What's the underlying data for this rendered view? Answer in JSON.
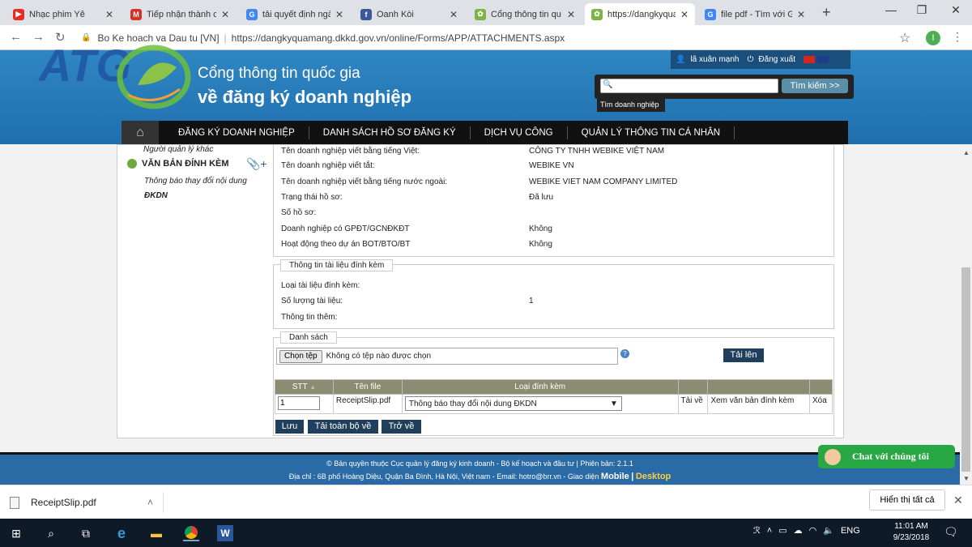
{
  "browser": {
    "tabs": [
      {
        "title": "Nhạc phim Yê",
        "fav_color": "#e52d27",
        "fav_char": "▶"
      },
      {
        "title": "Tiếp nhận thành c",
        "fav_color": "#d93025",
        "fav_char": "M"
      },
      {
        "title": "tải quyết định ngà",
        "fav_color": "#4285f4",
        "fav_char": "G"
      },
      {
        "title": "Oanh Kòi",
        "fav_color": "#3b5998",
        "fav_char": "f"
      },
      {
        "title": "Cổng thông tin qu",
        "fav_color": "#7cb342",
        "fav_char": "✿"
      },
      {
        "title": "https://dangkyqua",
        "fav_color": "#7cb342",
        "fav_char": "✿"
      },
      {
        "title": "file pdf - Tìm với G",
        "fav_color": "#4285f4",
        "fav_char": "G"
      }
    ],
    "site_name": "Bo Ke hoach va Dau tu [VN]",
    "url": "https://dangkyquamang.dkkd.gov.vn/online/Forms/APP/ATTACHMENTS.aspx",
    "profile_initial": "I"
  },
  "header": {
    "title_line1": "Cổng thông tin quốc gia",
    "title_line2": "về đăng ký doanh nghiệp",
    "user_name": "lã xuân mạnh",
    "logout": "Đăng xuất",
    "search_button": "Tìm kiếm >>",
    "search_hint": "Tìm doanh nghiệp",
    "search_value": ""
  },
  "nav": [
    "ĐĂNG KÝ DOANH NGHIỆP",
    "DANH SÁCH HỒ SƠ ĐĂNG KÝ",
    "DỊCH VỤ CÔNG",
    "QUẢN LÝ THÔNG TIN CÁ NHÂN"
  ],
  "sidebar": {
    "prev_item": "Người quản lý khác",
    "active_item": "VĂN BẢN ĐÍNH KÈM",
    "sub_item_line1": "Thông báo thay đổi nội dung",
    "sub_item_line2": "ĐKDN"
  },
  "company_info": [
    {
      "label": "Tên doanh nghiệp viết bằng tiếng Việt:",
      "value": "CÔNG TY TNHH WEBIKE VIỆT NAM"
    },
    {
      "label": "Tên doanh nghiệp viết tắt:",
      "value": "WEBIKE VN"
    },
    {
      "label": "Tên doanh nghiệp viết bằng tiếng nước ngoài:",
      "value": "WEBIKE VIET NAM COMPANY LIMITED"
    },
    {
      "label": "Trạng thái hồ sơ:",
      "value": "Đã lưu"
    },
    {
      "label": "Số hồ sơ:",
      "value": ""
    },
    {
      "label": "Doanh nghiệp có GPĐT/GCNĐKĐT",
      "value": "Không"
    },
    {
      "label": "Hoạt động theo dự án BOT/BTO/BT",
      "value": "Không"
    }
  ],
  "attachment_info": {
    "legend": "Thông tin tài liệu đính kèm",
    "rows": [
      {
        "label": "Loại tài liệu đính kèm:",
        "value": ""
      },
      {
        "label": "Số lượng tài liệu:",
        "value": "1"
      },
      {
        "label": "Thông tin thêm:",
        "value": ""
      }
    ]
  },
  "list": {
    "legend": "Danh sách",
    "choose_file": "Chọn tệp",
    "no_file": "Không có tệp nào được chọn",
    "upload": "Tải lên",
    "columns": [
      "STT",
      "Tên file",
      "Loại đính kèm"
    ],
    "row": {
      "stt": "1",
      "file_name": "ReceiptSlip.pdf",
      "type": "Thông báo thay đổi nội dung ĐKDN",
      "download": "Tải về",
      "view": "Xem văn bản đính kèm",
      "delete": "Xóa"
    },
    "save": "Lưu",
    "download_all": "Tải toàn bộ về",
    "back": "Trở về"
  },
  "footer": {
    "line1": "© Bản quyền thuộc Cục quản lý đăng ký kinh doanh - Bộ kế hoạch và đầu tư | Phiên bản: 2.1.1",
    "line2": "Địa chỉ : 6B phố Hoàng Diệu, Quận Ba Đình, Hà Nội, Việt nam - Email: hotro@brr.vn - Giao diện",
    "mobile": "Mobile",
    "sep": "|",
    "desktop": "Desktop",
    "chat": "Chat với chúng tôi"
  },
  "download_bar": {
    "file": "ReceiptSlip.pdf",
    "show_all": "Hiển thị tất cả"
  },
  "taskbar": {
    "lang": "ENG",
    "time": "11:01 AM",
    "date": "9/23/2018"
  }
}
